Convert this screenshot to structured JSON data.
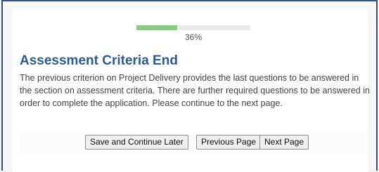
{
  "progress": {
    "percent_value": 36,
    "label": "36%"
  },
  "page": {
    "title": "Assessment Criteria End",
    "body": "The previous criterion on Project Delivery provides the last questions to be answered in the section on assessment criteria. There are further required questions to be answered in order to complete the application. Please continue to the next page."
  },
  "buttons": {
    "save_label": "Save and Continue Later",
    "previous_label": "Previous Page",
    "next_label": "Next Page"
  },
  "colors": {
    "progress_fill": "#86cf7e",
    "title": "#2b5a94",
    "frame_border": "#2d4f86"
  }
}
